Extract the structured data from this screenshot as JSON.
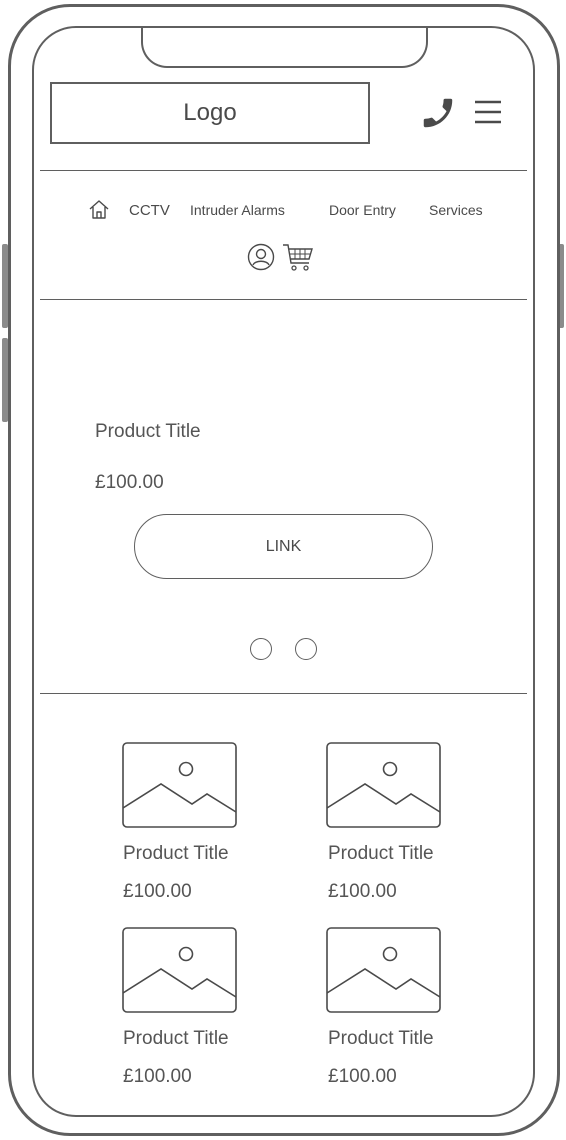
{
  "header": {
    "logo_text": "Logo",
    "phone_icon": "phone-icon",
    "menu_icon": "hamburger-menu-icon"
  },
  "nav": {
    "home_icon": "home-icon",
    "items": [
      {
        "label": "CCTV"
      },
      {
        "label": "Intruder Alarms"
      },
      {
        "label": "Door Entry"
      },
      {
        "label": "Services"
      }
    ],
    "account_icon": "user-account-icon",
    "cart_icon": "shopping-cart-icon"
  },
  "hero": {
    "product_title": "Product Title",
    "price": "£100.00",
    "link_label": "LINK",
    "carousel_dots": 2
  },
  "products": [
    {
      "title": "Product Title",
      "price": "£100.00",
      "image_icon": "image-placeholder-icon"
    },
    {
      "title": "Product Title",
      "price": "£100.00",
      "image_icon": "image-placeholder-icon"
    },
    {
      "title": "Product Title",
      "price": "£100.00",
      "image_icon": "image-placeholder-icon"
    },
    {
      "title": "Product Title",
      "price": "£100.00",
      "image_icon": "image-placeholder-icon"
    }
  ],
  "colors": {
    "stroke": "#5f5f5f",
    "text": "#4a4a4a",
    "background": "#ffffff"
  }
}
